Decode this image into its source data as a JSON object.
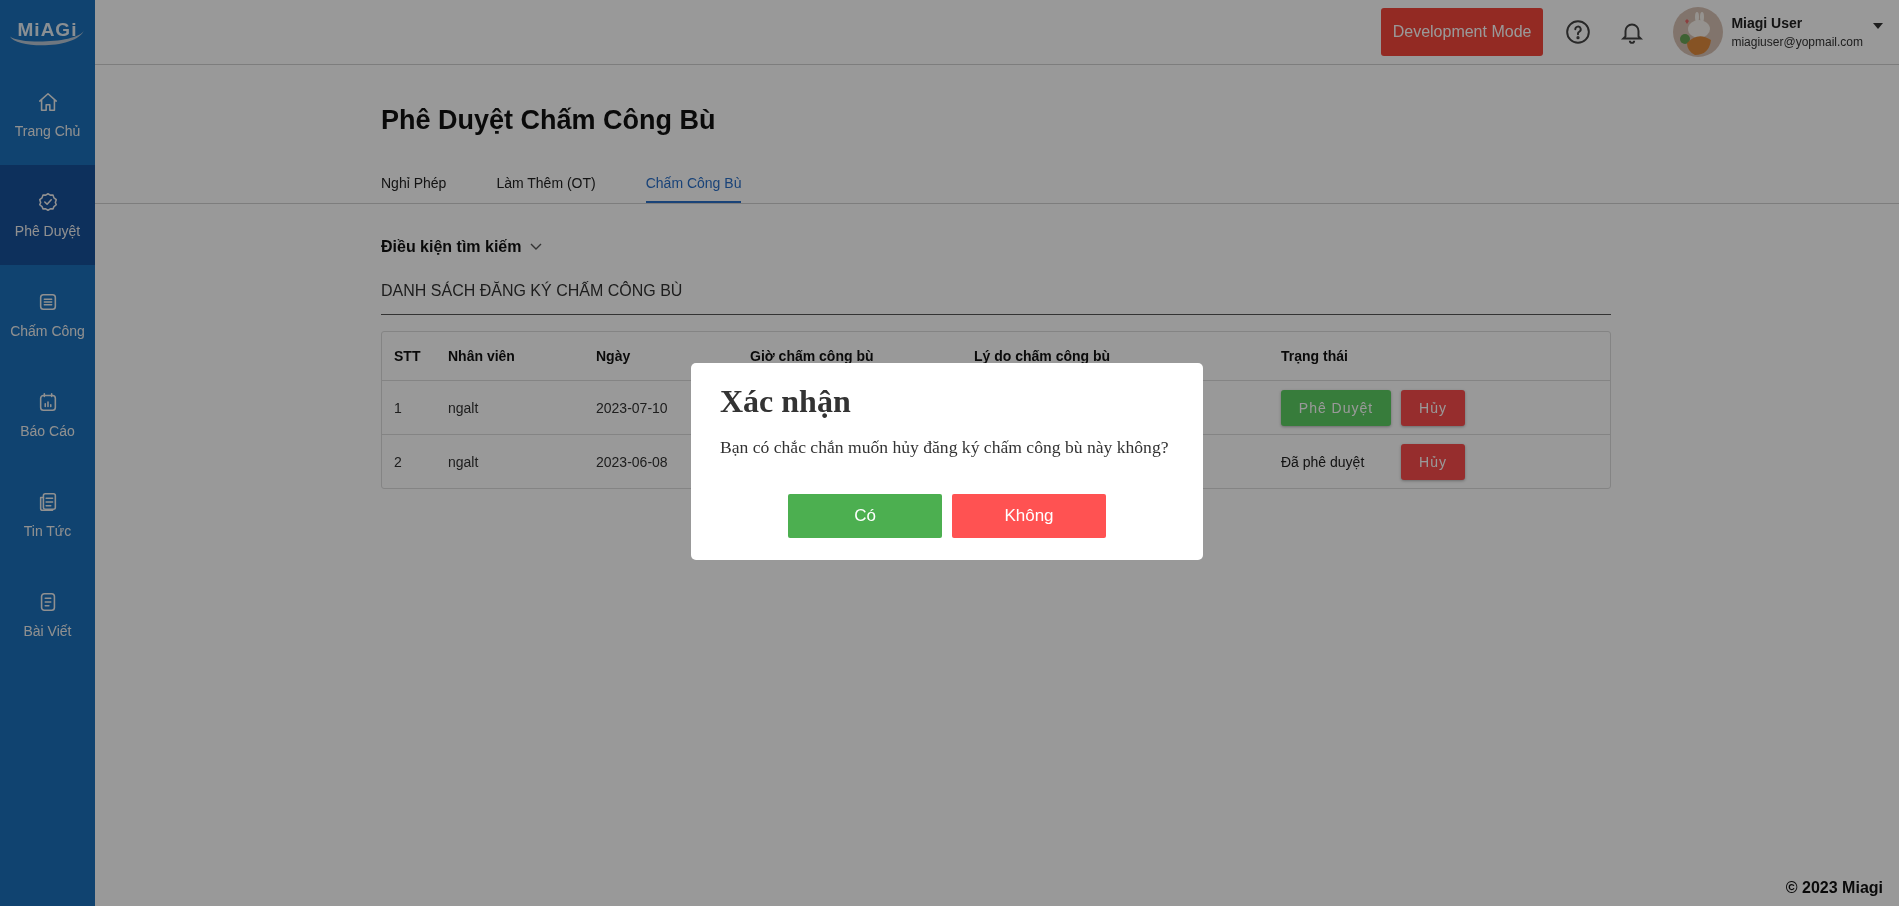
{
  "sidebar": {
    "logo": "MiAGi",
    "items": [
      {
        "label": "Trang Chủ",
        "selected": false
      },
      {
        "label": "Phê Duyệt",
        "selected": true
      },
      {
        "label": "Chấm Công",
        "selected": false
      },
      {
        "label": "Báo Cáo",
        "selected": false
      },
      {
        "label": "Tin Tức",
        "selected": false
      },
      {
        "label": "Bài Viết",
        "selected": false
      }
    ]
  },
  "header": {
    "mode_button": "Development Mode",
    "user": {
      "name": "Miagi User",
      "email": "miagiuser@yopmail.com"
    }
  },
  "page": {
    "title": "Phê Duyệt Chấm Công Bù",
    "tabs": [
      {
        "label": "Nghỉ Phép",
        "selected": false
      },
      {
        "label": "Làm Thêm (OT)",
        "selected": false
      },
      {
        "label": "Chấm Công Bù",
        "selected": true
      }
    ],
    "filter": {
      "label": "Điều kiện tìm kiếm",
      "expanded": false
    },
    "section_title": "DANH SÁCH ĐĂNG KÝ CHẤM CÔNG BÙ",
    "table": {
      "columns": [
        "STT",
        "Nhân viên",
        "Ngày",
        "Giờ chấm công bù",
        "Lý do chấm công bù",
        "Trạng thái"
      ],
      "rows": [
        {
          "cells": [
            "1",
            "ngalt",
            "2023-07-10"
          ],
          "status": [
            {
              "kind": "approve",
              "label": "Phê Duyệt"
            },
            {
              "kind": "cancel",
              "label": "Hủy"
            }
          ]
        },
        {
          "cells": [
            "2",
            "ngalt",
            "2023-06-08"
          ],
          "status": [
            {
              "kind": "text",
              "label": "Đã phê duyệt"
            },
            {
              "kind": "cancel",
              "label": "Hủy"
            }
          ]
        }
      ]
    }
  },
  "footer": "© 2023 Miagi",
  "dialog": {
    "title": "Xác nhận",
    "message": "Bạn có chắc chắn muốn hủy đăng ký chấm công bù này không?",
    "buttons": [
      {
        "kind": "confirm",
        "label": "Có"
      },
      {
        "kind": "deny",
        "label": "Không"
      }
    ]
  }
}
